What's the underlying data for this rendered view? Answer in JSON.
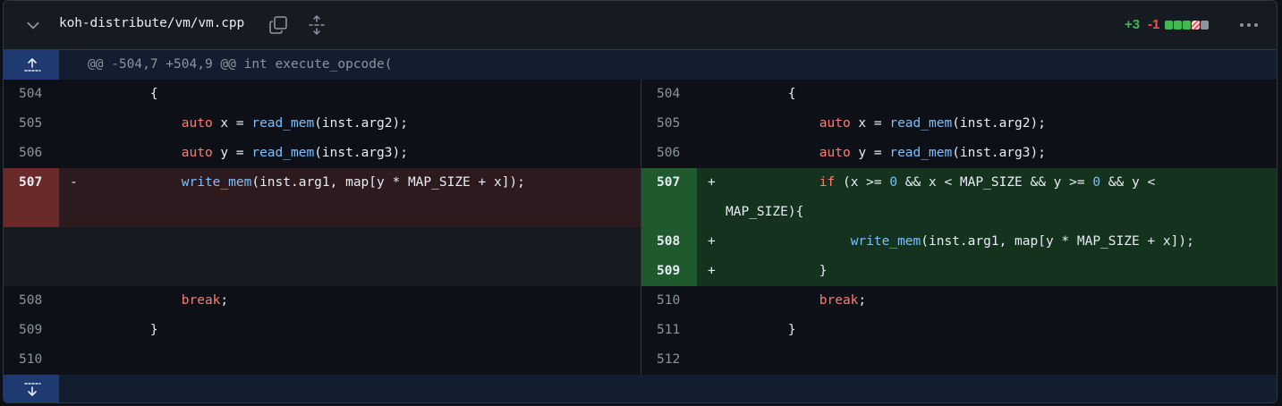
{
  "header": {
    "file_path": "koh-distribute/vm/vm.cpp",
    "additions": "+3",
    "deletions": "-1",
    "diffstat_blocks": [
      "#3fb950",
      "#3fb950",
      "#3fb950",
      "#f85149",
      "#8b949e"
    ]
  },
  "hunk": {
    "header": "@@ -504,7 +504,9 @@ int execute_opcode("
  },
  "left": {
    "rows": [
      {
        "num": "504",
        "mark": "",
        "code": "        {"
      },
      {
        "num": "505",
        "mark": "",
        "code": "            auto x = read_mem(inst.arg2);"
      },
      {
        "num": "506",
        "mark": "",
        "code": "            auto y = read_mem(inst.arg3);"
      },
      {
        "num": "507",
        "mark": "-",
        "code": "            write_mem(inst.arg1, map[y * MAP_SIZE + x]);"
      },
      {
        "num": "508",
        "mark": "",
        "code": "            break;"
      },
      {
        "num": "509",
        "mark": "",
        "code": "        }"
      },
      {
        "num": "510",
        "mark": "",
        "code": ""
      }
    ]
  },
  "right": {
    "rows": [
      {
        "num": "504",
        "mark": "",
        "code": "        {"
      },
      {
        "num": "505",
        "mark": "",
        "code": "            auto x = read_mem(inst.arg2);"
      },
      {
        "num": "506",
        "mark": "",
        "code": "            auto y = read_mem(inst.arg3);"
      },
      {
        "num": "507",
        "mark": "+",
        "code": "            if (x >= 0 && x < MAP_SIZE && y >= 0 && y <",
        "code_wrap": "MAP_SIZE){"
      },
      {
        "num": "508",
        "mark": "+",
        "code": "                write_mem(inst.arg1, map[y * MAP_SIZE + x]);"
      },
      {
        "num": "509",
        "mark": "+",
        "code": "            }"
      },
      {
        "num": "510",
        "mark": "",
        "code": "            break;"
      },
      {
        "num": "511",
        "mark": "",
        "code": "        }"
      },
      {
        "num": "512",
        "mark": "",
        "code": ""
      }
    ]
  },
  "icons": {
    "collapse": "chevron-down-icon",
    "copy": "copy-icon",
    "expand_all": "unfold-icon",
    "menu": "kebab-icon",
    "expand_up": "expand-up-icon",
    "expand_down": "expand-down-icon"
  }
}
